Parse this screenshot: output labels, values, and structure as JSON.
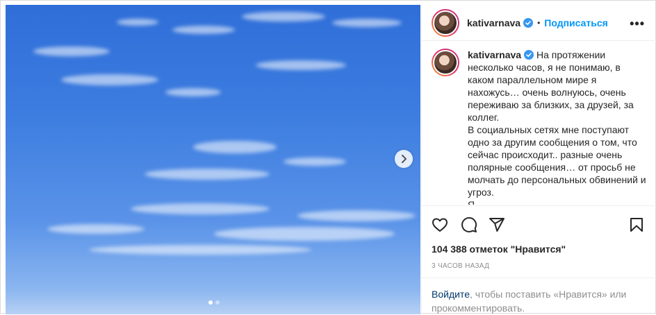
{
  "post": {
    "author": "kativarnava",
    "separator": "•",
    "follow_label": "Подписаться",
    "more_label": "•••",
    "caption": "На протяжении несколько часов, я не понимаю, в каком параллельном мире я нахожусь… очень волнуюсь, очень переживаю за близких, за друзей, за коллег.\nВ социальных сетях мне поступают одно за другим сообщения о том, что сейчас происходит.. разные очень полярные сообщения… от просьб не молчать до персональных обвинений и угроз.\nЯ",
    "likes": "104 388 отметок \"Нравится\"",
    "time": "3 ЧАСОВ НАЗАД",
    "login_link": "Войдите",
    "login_text": ", чтобы поставить «Нравится» или прокомментировать."
  },
  "media": {
    "slide_count": 2,
    "active_slide": 1
  },
  "colors": {
    "accent": "#0095f6",
    "sky": "#3d7de0"
  },
  "icons": [
    "verified-icon",
    "more-icon",
    "heart-icon",
    "comment-icon",
    "share-icon",
    "bookmark-icon",
    "chevron-right-icon"
  ]
}
